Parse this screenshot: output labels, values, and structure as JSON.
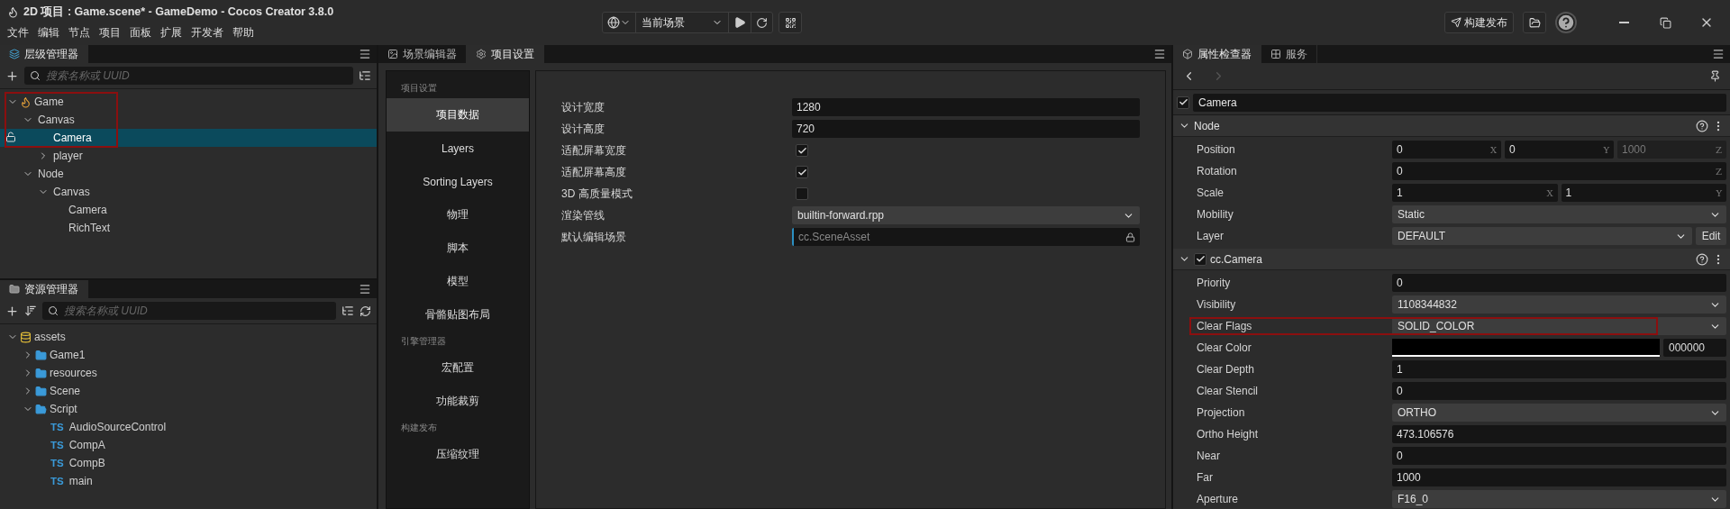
{
  "window": {
    "title": "2D 项目 : Game.scene* - GameDemo - Cocos Creator 3.8.0"
  },
  "menu": [
    "文件",
    "编辑",
    "节点",
    "项目",
    "面板",
    "扩展",
    "开发者",
    "帮助"
  ],
  "toolbar": {
    "scene_selector": "当前场景",
    "build_button": "构建发布"
  },
  "hierarchy": {
    "tab": "层级管理器",
    "search": {
      "placeholder": "搜索名称或 UUID"
    },
    "annotated": true,
    "tree": [
      {
        "name": "Game",
        "kind": "scene",
        "expanded": true,
        "selected": false,
        "children": [
          {
            "name": "Canvas",
            "kind": "group",
            "expanded": true,
            "selected": false,
            "children": [
              {
                "name": "Camera",
                "selected": true
              },
              {
                "name": "player",
                "kind": "group",
                "expanded": false,
                "selected": false
              }
            ]
          },
          {
            "name": "Node",
            "kind": "group",
            "expanded": true,
            "selected": false,
            "children": [
              {
                "name": "Canvas",
                "kind": "group",
                "expanded": true,
                "selected": false,
                "children": [
                  {
                    "name": "Camera",
                    "selected": false
                  },
                  {
                    "name": "RichText",
                    "selected": false
                  }
                ]
              }
            ]
          }
        ]
      }
    ]
  },
  "assets": {
    "tab": "资源管理器",
    "search": {
      "placeholder": "搜索名称或 UUID"
    },
    "tree": [
      {
        "name": "assets",
        "kind": "db",
        "expanded": true,
        "children": [
          {
            "name": "Game1",
            "kind": "folder",
            "expanded": false
          },
          {
            "name": "resources",
            "kind": "folder",
            "expanded": false
          },
          {
            "name": "Scene",
            "kind": "folder",
            "expanded": false
          },
          {
            "name": "Script",
            "kind": "folder",
            "expanded": true,
            "children": [
              {
                "name": "AudioSourceControl",
                "kind": "ts",
                "badge": "TS"
              },
              {
                "name": "CompA",
                "kind": "ts",
                "badge": "TS"
              },
              {
                "name": "CompB",
                "kind": "ts",
                "badge": "TS"
              },
              {
                "name": "main",
                "kind": "ts",
                "badge": "TS"
              }
            ]
          }
        ]
      }
    ]
  },
  "editor_tabs": [
    {
      "label": "场景编辑器",
      "kind": "scene",
      "selected": false
    },
    {
      "label": "项目设置",
      "kind": "settings",
      "selected": true
    }
  ],
  "settings_nav": [
    {
      "title": "项目设置",
      "items": [
        {
          "label": "项目数据",
          "selected": true
        },
        {
          "label": "Layers",
          "selected": false
        },
        {
          "label": "Sorting Layers",
          "selected": false
        },
        {
          "label": "物理",
          "selected": false
        },
        {
          "label": "脚本",
          "selected": false
        },
        {
          "label": "模型",
          "selected": false
        },
        {
          "label": "骨骼贴图布局",
          "selected": false
        }
      ]
    },
    {
      "title": "引擎管理器",
      "items": [
        {
          "label": "宏配置",
          "selected": false
        },
        {
          "label": "功能裁剪",
          "selected": false
        }
      ]
    },
    {
      "title": "构建发布",
      "items": [
        {
          "label": "压缩纹理",
          "selected": false
        }
      ]
    }
  ],
  "settings_form": [
    {
      "label": "设计宽度",
      "kind": "text",
      "value": "1280"
    },
    {
      "label": "设计高度",
      "kind": "text",
      "value": "720"
    },
    {
      "label": "适配屏幕宽度",
      "kind": "checkbox",
      "checked": true
    },
    {
      "label": "适配屏幕高度",
      "kind": "checkbox",
      "checked": true
    },
    {
      "label": "3D 高质量模式",
      "kind": "checkbox",
      "checked": false
    },
    {
      "label": "渲染管线",
      "kind": "select",
      "value": "builtin-forward.rpp"
    },
    {
      "label": "默认编辑场景",
      "kind": "asset",
      "placeholder": "cc.SceneAsset"
    }
  ],
  "inspector": {
    "tabs": [
      {
        "label": "属性检查器",
        "kind": "inspector",
        "selected": true
      },
      {
        "label": "服务",
        "kind": "services",
        "selected": false
      }
    ],
    "node_name": {
      "value": "Camera",
      "enabled": true
    },
    "sections": [
      {
        "title": "Node",
        "expanded": true,
        "properties": [
          {
            "label": "Position",
            "kind": "vector",
            "fields": [
              {
                "value": "0",
                "axis": "X",
                "disabled": false
              },
              {
                "value": "0",
                "axis": "Y",
                "disabled": false
              },
              {
                "value": "1000",
                "axis": "Z",
                "disabled": true
              }
            ]
          },
          {
            "label": "Rotation",
            "kind": "vector",
            "fields": [
              {
                "value": "0",
                "axis": "Z",
                "disabled": false
              }
            ]
          },
          {
            "label": "Scale",
            "kind": "vector",
            "fields": [
              {
                "value": "1",
                "axis": "X",
                "disabled": false
              },
              {
                "value": "1",
                "axis": "Y",
                "disabled": false
              }
            ]
          },
          {
            "label": "Mobility",
            "kind": "select",
            "value": "Static"
          },
          {
            "label": "Layer",
            "kind": "select",
            "value": "DEFAULT",
            "button": "Edit"
          }
        ]
      },
      {
        "title": "cc.Camera",
        "enabled": true,
        "expanded": true,
        "properties": [
          {
            "label": "Priority",
            "kind": "number",
            "value": "0"
          },
          {
            "label": "Visibility",
            "kind": "select",
            "value": "1108344832"
          },
          {
            "label": "Clear Flags",
            "kind": "select",
            "value": "SOLID_COLOR",
            "annotated": true
          },
          {
            "label": "Clear Color",
            "kind": "color",
            "color": "#000000",
            "value": "000000"
          },
          {
            "label": "Clear Depth",
            "kind": "number",
            "value": "1"
          },
          {
            "label": "Clear Stencil",
            "kind": "number",
            "value": "0"
          },
          {
            "label": "Projection",
            "kind": "select",
            "value": "ORTHO"
          },
          {
            "label": "Ortho Height",
            "kind": "number",
            "value": "473.106576"
          },
          {
            "label": "Near",
            "kind": "number",
            "value": "0"
          },
          {
            "label": "Far",
            "kind": "number",
            "value": "1000"
          },
          {
            "label": "Aperture",
            "kind": "select",
            "value": "F16_0"
          }
        ]
      }
    ]
  }
}
